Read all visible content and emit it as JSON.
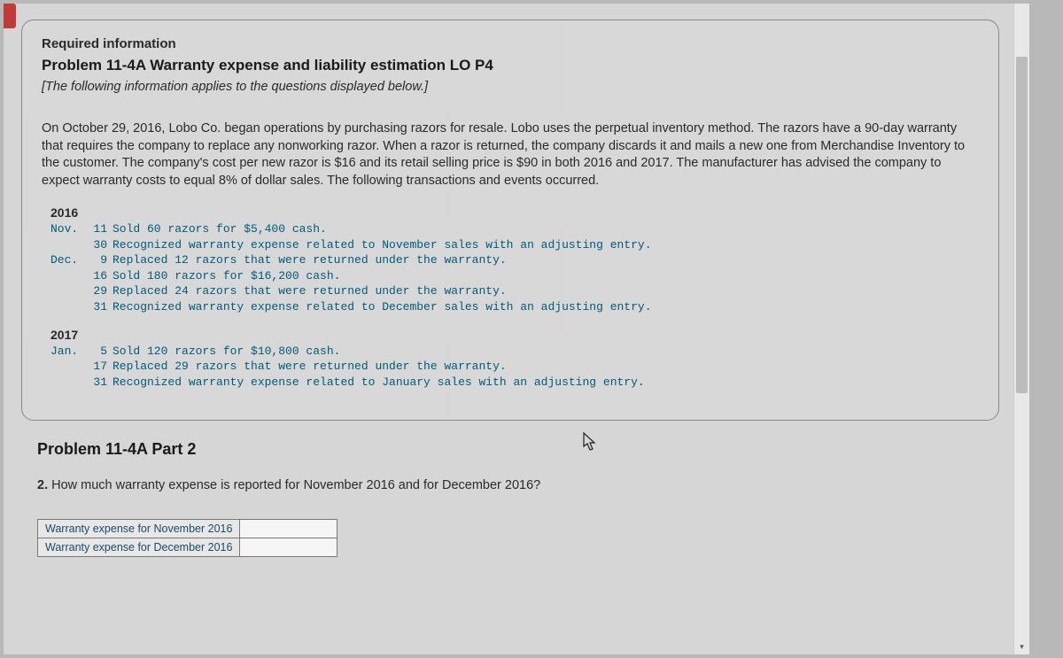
{
  "header": {
    "required_info": "Required information",
    "problem_title": "Problem 11-4A Warranty expense and liability estimation LO P4",
    "italic_note": "[The following information applies to the questions displayed below.]"
  },
  "paragraph": "On October 29, 2016, Lobo Co. began operations by purchasing razors for resale. Lobo uses the perpetual inventory method. The razors have a 90-day warranty that requires the company to replace any nonworking razor. When a razor is returned, the company discards it and mails a new one from Merchandise Inventory to the customer. The company's cost per new razor is $16 and its retail selling price is $90 in both 2016 and 2017. The manufacturer has advised the company to expect warranty costs to equal 8% of dollar sales. The following transactions and events occurred.",
  "years": {
    "y2016": {
      "label": "2016",
      "lines": [
        {
          "mo": "Nov.",
          "day": "11",
          "text": "Sold 60 razors for $5,400 cash."
        },
        {
          "mo": "",
          "day": "30",
          "text": "Recognized warranty expense related to November sales with an adjusting entry."
        },
        {
          "mo": "Dec.",
          "day": "9",
          "text": "Replaced 12 razors that were returned under the warranty."
        },
        {
          "mo": "",
          "day": "16",
          "text": "Sold 180 razors for $16,200 cash."
        },
        {
          "mo": "",
          "day": "29",
          "text": "Replaced 24 razors that were returned under the warranty."
        },
        {
          "mo": "",
          "day": "31",
          "text": "Recognized warranty expense related to December sales with an adjusting entry."
        }
      ]
    },
    "y2017": {
      "label": "2017",
      "lines": [
        {
          "mo": "Jan.",
          "day": "5",
          "text": "Sold 120 razors for $10,800 cash."
        },
        {
          "mo": "",
          "day": "17",
          "text": "Replaced 29 razors that were returned under the warranty."
        },
        {
          "mo": "",
          "day": "31",
          "text": "Recognized warranty expense related to January sales with an adjusting entry."
        }
      ]
    }
  },
  "part2": {
    "title": "Problem 11-4A Part 2",
    "qnum": "2.",
    "question": " How much warranty expense is reported for November 2016 and for December 2016?",
    "rows": [
      {
        "label": "Warranty expense for November 2016",
        "value": ""
      },
      {
        "label": "Warranty expense for December 2016",
        "value": ""
      }
    ]
  }
}
